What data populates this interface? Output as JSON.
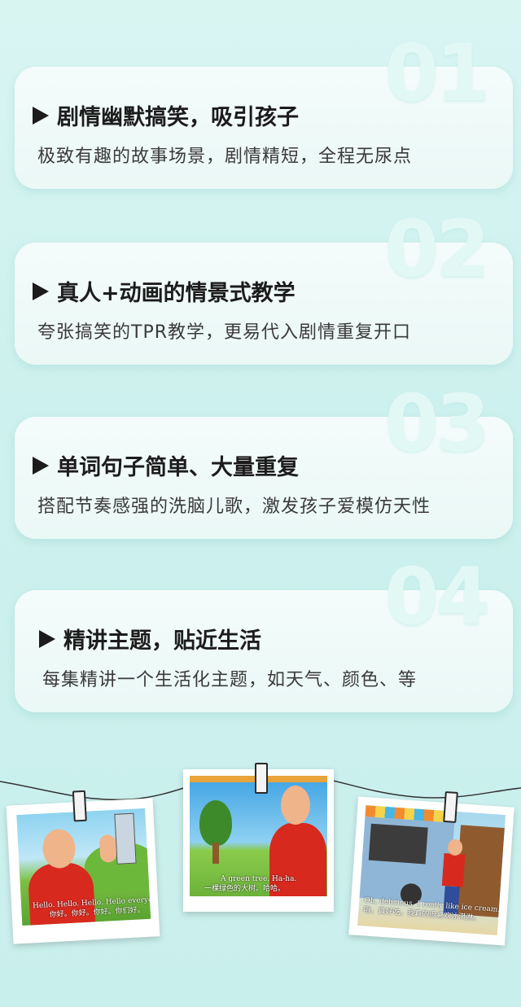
{
  "cards": [
    {
      "num": "01",
      "title": "剧情幽默搞笑，吸引孩子",
      "desc": "极致有趣的故事场景，剧情精短，全程无尿点"
    },
    {
      "num": "02",
      "title": "真人+动画的情景式教学",
      "desc": "夸张搞笑的TPR教学，更易代入剧情重复开口"
    },
    {
      "num": "03",
      "title": "单词句子简单、大量重复",
      "desc": "搭配节奏感强的洗脑儿歌，激发孩子爱模仿天性"
    },
    {
      "num": "04",
      "title": "精讲主题，贴近生活",
      "desc": "每集精讲一个生活化主题，如天气、颜色、等"
    }
  ],
  "photos": {
    "p1": {
      "cap1": "Hello. Hello. Hello. Hello everyone.",
      "cap2": "你好。你好。你好。你们好。"
    },
    "p2": {
      "cap1": "A green tree. Ha-ha.",
      "cap2": "一棵绿色的大树。哈哈。"
    },
    "p3": {
      "cap1": "Oh, delicious. I really like ice cream.",
      "cap2": "哦，真好吃。我真的很喜欢冰淇淋。"
    }
  },
  "colors": {
    "bg": "#cdf1ee",
    "card": "#eef9f7",
    "text": "#1c1c1c"
  }
}
